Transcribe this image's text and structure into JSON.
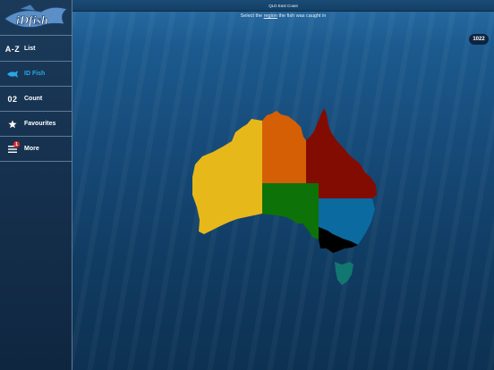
{
  "sidebar": {
    "logo_text": "iDfish",
    "items": [
      {
        "icon_text": "A-Z",
        "label": "List"
      },
      {
        "icon": "fish-icon",
        "label": "ID Fish",
        "active": true
      },
      {
        "icon_text": "02",
        "label": "Count"
      },
      {
        "icon": "star-icon",
        "label": "Favourites"
      },
      {
        "icon": "menu-icon",
        "label": "More",
        "badge": "1"
      }
    ]
  },
  "header": {
    "title": "QLD East Coast"
  },
  "instruction": {
    "before": "Select the ",
    "link": "region",
    "after": " the fish was caught in"
  },
  "count_badge": "1022",
  "map": {
    "regions": [
      {
        "name": "Western Australia",
        "color": "#e6b81a"
      },
      {
        "name": "Northern Territory",
        "color": "#d45f05"
      },
      {
        "name": "South Australia",
        "color": "#0d7308"
      },
      {
        "name": "Queensland",
        "color": "#830c02"
      },
      {
        "name": "New South Wales",
        "color": "#0b6aa0"
      },
      {
        "name": "Victoria",
        "color": "#000000"
      },
      {
        "name": "Tasmania",
        "color": "#127771"
      }
    ]
  }
}
